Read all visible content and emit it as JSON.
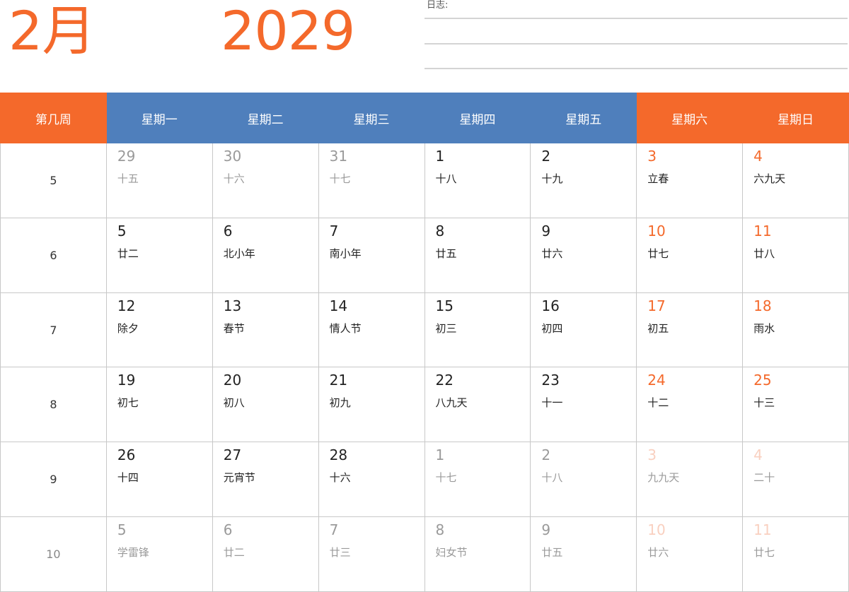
{
  "header": {
    "month": "2月",
    "year": "2029",
    "notes_label": "日志:"
  },
  "colors": {
    "accent": "#f4692b",
    "weekday_header": "#4f7fbc",
    "grid": "#c8c8c8"
  },
  "columns": [
    "第几周",
    "星期一",
    "星期二",
    "星期三",
    "星期四",
    "星期五",
    "星期六",
    "星期日"
  ],
  "weeks": [
    {
      "week": "5",
      "days": [
        {
          "day": "29",
          "lunar": "十五",
          "other": true
        },
        {
          "day": "30",
          "lunar": "十六",
          "other": true
        },
        {
          "day": "31",
          "lunar": "十七",
          "other": true
        },
        {
          "day": "1",
          "lunar": "十八",
          "other": false
        },
        {
          "day": "2",
          "lunar": "十九",
          "other": false
        },
        {
          "day": "3",
          "lunar": "立春",
          "other": false
        },
        {
          "day": "4",
          "lunar": "六九天",
          "other": false
        }
      ]
    },
    {
      "week": "6",
      "days": [
        {
          "day": "5",
          "lunar": "廿二",
          "other": false
        },
        {
          "day": "6",
          "lunar": "北小年",
          "other": false
        },
        {
          "day": "7",
          "lunar": "南小年",
          "other": false
        },
        {
          "day": "8",
          "lunar": "廿五",
          "other": false
        },
        {
          "day": "9",
          "lunar": "廿六",
          "other": false
        },
        {
          "day": "10",
          "lunar": "廿七",
          "other": false
        },
        {
          "day": "11",
          "lunar": "廿八",
          "other": false
        }
      ]
    },
    {
      "week": "7",
      "days": [
        {
          "day": "12",
          "lunar": "除夕",
          "other": false
        },
        {
          "day": "13",
          "lunar": "春节",
          "other": false
        },
        {
          "day": "14",
          "lunar": "情人节",
          "other": false
        },
        {
          "day": "15",
          "lunar": "初三",
          "other": false
        },
        {
          "day": "16",
          "lunar": "初四",
          "other": false
        },
        {
          "day": "17",
          "lunar": "初五",
          "other": false
        },
        {
          "day": "18",
          "lunar": "雨水",
          "other": false
        }
      ]
    },
    {
      "week": "8",
      "days": [
        {
          "day": "19",
          "lunar": "初七",
          "other": false
        },
        {
          "day": "20",
          "lunar": "初八",
          "other": false
        },
        {
          "day": "21",
          "lunar": "初九",
          "other": false
        },
        {
          "day": "22",
          "lunar": "八九天",
          "other": false
        },
        {
          "day": "23",
          "lunar": "十一",
          "other": false
        },
        {
          "day": "24",
          "lunar": "十二",
          "other": false
        },
        {
          "day": "25",
          "lunar": "十三",
          "other": false
        }
      ]
    },
    {
      "week": "9",
      "days": [
        {
          "day": "26",
          "lunar": "十四",
          "other": false
        },
        {
          "day": "27",
          "lunar": "元宵节",
          "other": false
        },
        {
          "day": "28",
          "lunar": "十六",
          "other": false
        },
        {
          "day": "1",
          "lunar": "十七",
          "other": true
        },
        {
          "day": "2",
          "lunar": "十八",
          "other": true
        },
        {
          "day": "3",
          "lunar": "九九天",
          "other": true
        },
        {
          "day": "4",
          "lunar": "二十",
          "other": true
        }
      ]
    },
    {
      "week": "10",
      "dim": true,
      "days": [
        {
          "day": "5",
          "lunar": "学雷锋",
          "other": true
        },
        {
          "day": "6",
          "lunar": "廿二",
          "other": true
        },
        {
          "day": "7",
          "lunar": "廿三",
          "other": true
        },
        {
          "day": "8",
          "lunar": "妇女节",
          "other": true
        },
        {
          "day": "9",
          "lunar": "廿五",
          "other": true
        },
        {
          "day": "10",
          "lunar": "廿六",
          "other": true
        },
        {
          "day": "11",
          "lunar": "廿七",
          "other": true
        }
      ]
    }
  ]
}
